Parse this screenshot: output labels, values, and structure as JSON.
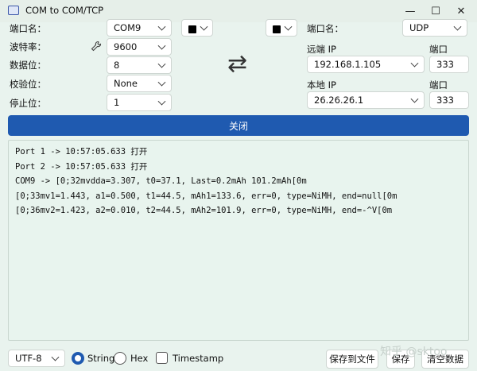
{
  "window": {
    "title": "COM to COM/TCP",
    "minimize": "—",
    "maximize": "☐",
    "close": "✕"
  },
  "serial": {
    "port_label": "端口名：",
    "port_value": "COM9",
    "baud_label": "波特率：",
    "baud_value": "9600",
    "data_bits_label": "数据位：",
    "data_bits_value": "8",
    "parity_label": "校验位：",
    "parity_value": "None",
    "stop_bits_label": "停止位：",
    "stop_bits_value": "1"
  },
  "network": {
    "port_label": "端口名：",
    "protocol_value": "UDP",
    "remote_ip_label": "远端 IP",
    "remote_ip_value": "192.168.1.105",
    "remote_port_label": "端口",
    "remote_port_value": "333",
    "local_ip_label": "本地 IP",
    "local_ip_value": "26.26.26.1",
    "local_port_label": "端口",
    "local_port_value": "333"
  },
  "swap_symbol": "⇄",
  "close_button": "关闭",
  "log_lines": [
    "Port 1 -> 10:57:05.633 打开",
    "Port 2 -> 10:57:05.633 打开",
    "COM9 -> [0;32mvdda=3.307, t0=37.1, Last=0.2mAh 101.2mAh[0m",
    "[0;33mv1=1.443, a1=0.500, t1=44.5, mAh1=133.6, err=0, type=NiMH, end=null[0m",
    "[0;36mv2=1.423, a2=0.010, t2=44.5, mAh2=101.9, err=0, type=NiMH, end=-^V[0m"
  ],
  "footer": {
    "encoding_value": "UTF-8",
    "string_label": "String",
    "hex_label": "Hex",
    "timestamp_label": "Timestamp",
    "save_to_file": "保存到文件",
    "save": "保存",
    "clear": "清空数据",
    "watermark": "知乎 @sktoo"
  },
  "colors": {
    "accent": "#1f5ab0",
    "background": "#e9f3ee"
  },
  "icons": [
    "wrench-icon",
    "swap-icon",
    "chevron-down-icon",
    "app-icon"
  ]
}
